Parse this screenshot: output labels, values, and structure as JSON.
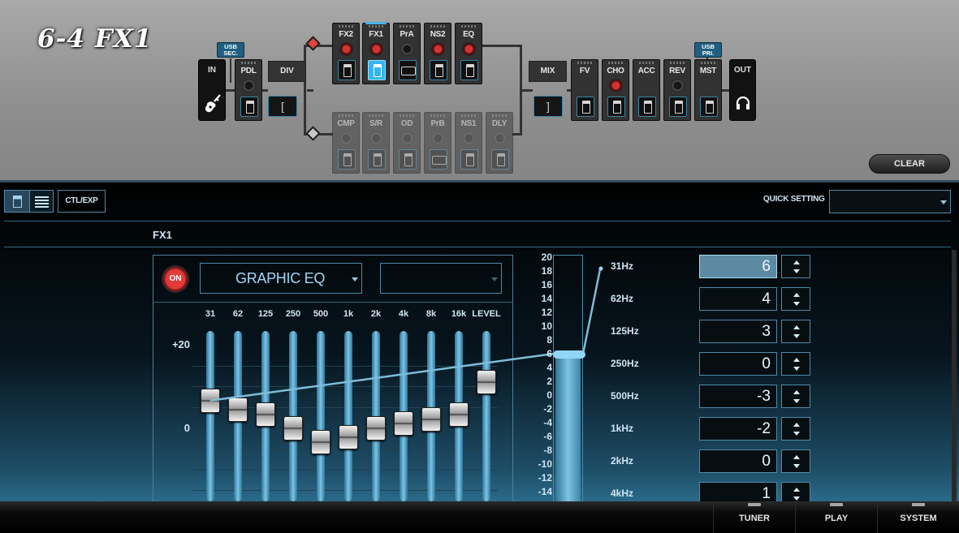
{
  "title": "6-4 FX1",
  "chain": {
    "in_label": "IN",
    "out_label": "OUT",
    "pdl": "PDL",
    "div": "DIV",
    "mix": "MIX",
    "usb_sec": [
      "USB",
      "SEC."
    ],
    "usb_pri": [
      "USB",
      "PRI."
    ],
    "upper": [
      "FX2",
      "FX1",
      "PrA",
      "NS2",
      "EQ"
    ],
    "lower": [
      "CMP",
      "S/R",
      "OD",
      "PrB",
      "NS1",
      "DLY"
    ],
    "post": [
      "FV",
      "CHO",
      "ACC",
      "REV",
      "MST"
    ],
    "div_glyph": "[",
    "mix_glyph": "]"
  },
  "clear_label": "CLEAR",
  "toolbar": {
    "ctl_exp": "CTL/EXP",
    "quick_setting_label": "QUICK SETTING",
    "quick_setting_value": ""
  },
  "section_label": "FX1",
  "effect": {
    "on_label": "ON",
    "type": "GRAPHIC EQ",
    "variation": ""
  },
  "bands": [
    "31",
    "62",
    "125",
    "250",
    "500",
    "1k",
    "2k",
    "4k",
    "8k",
    "16k",
    "LEVEL"
  ],
  "axis": {
    "top": "+20",
    "zero": "0"
  },
  "scale": [
    "20",
    "18",
    "16",
    "14",
    "12",
    "10",
    "8",
    "6",
    "4",
    "2",
    "0",
    "-2",
    "-4",
    "-6",
    "-8",
    "-10",
    "-12",
    "-14"
  ],
  "eq_values": [
    6,
    4,
    3,
    0,
    -3,
    -2,
    0,
    1,
    2,
    3,
    10
  ],
  "params": [
    {
      "freq": "31Hz",
      "value": "6"
    },
    {
      "freq": "62Hz",
      "value": "4"
    },
    {
      "freq": "125Hz",
      "value": "3"
    },
    {
      "freq": "250Hz",
      "value": "0"
    },
    {
      "freq": "500Hz",
      "value": "-3"
    },
    {
      "freq": "1kHz",
      "value": "-2"
    },
    {
      "freq": "2kHz",
      "value": "0"
    },
    {
      "freq": "4kHz",
      "value": "1"
    }
  ],
  "selected_value": 6,
  "nav": [
    "TUNER",
    "PLAY",
    "SYSTEM"
  ],
  "colors": {
    "accent": "#36b4ee",
    "on_red": "#e23a3a",
    "panel_bg": "#07151e"
  }
}
